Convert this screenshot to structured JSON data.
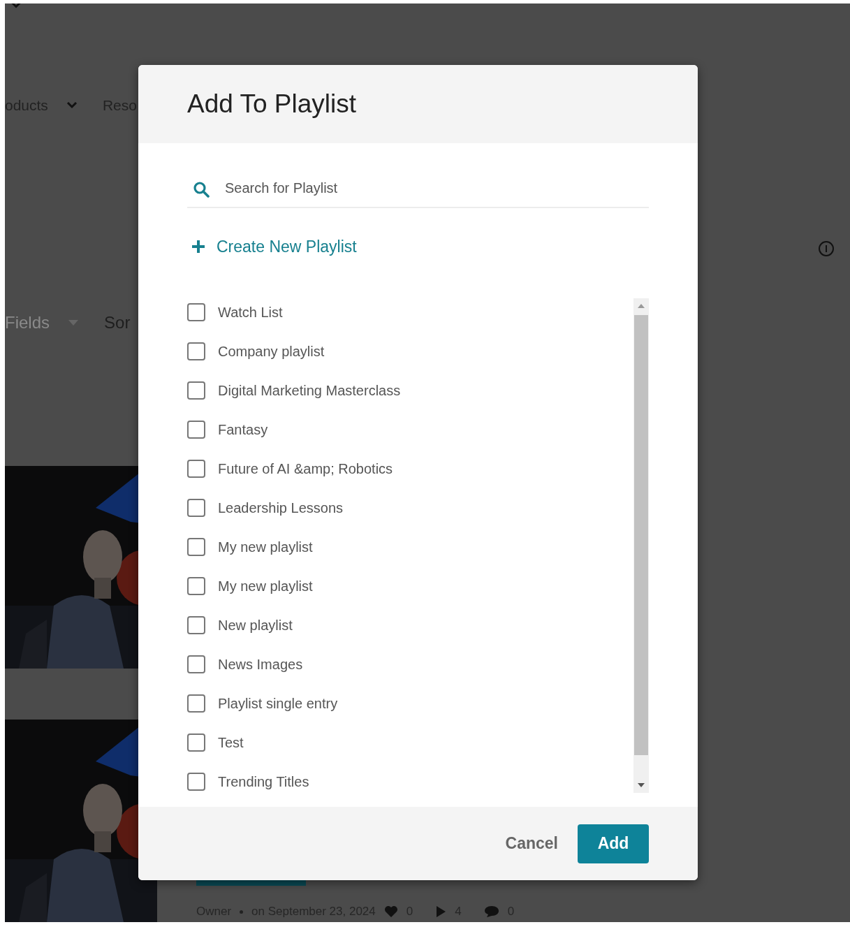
{
  "background": {
    "nav": [
      {
        "label": "oducts"
      },
      {
        "label": "Reso"
      }
    ],
    "filters": [
      {
        "label": "Fields",
        "disabled": true
      },
      {
        "label": "Sor",
        "disabled": false
      }
    ],
    "cards": [
      {
        "kind": "picture"
      },
      {
        "kind": "picture",
        "owner": "Owner",
        "date": "on September 23, 2024",
        "likes": "0",
        "plays": "4",
        "comments": "0"
      }
    ]
  },
  "dialog": {
    "title": "Add To Playlist",
    "search": {
      "placeholder": "Search for Playlist"
    },
    "create_label": "Create New Playlist",
    "playlists": [
      {
        "name": "Watch List",
        "checked": false
      },
      {
        "name": "Company playlist",
        "checked": false
      },
      {
        "name": "Digital Marketing Masterclass",
        "checked": false
      },
      {
        "name": "Fantasy",
        "checked": false
      },
      {
        "name": "Future of AI &amp; Robotics",
        "checked": false
      },
      {
        "name": "Leadership Lessons",
        "checked": false
      },
      {
        "name": "My new playlist",
        "checked": false
      },
      {
        "name": "My new playlist",
        "checked": false
      },
      {
        "name": "New playlist",
        "checked": false
      },
      {
        "name": "News Images",
        "checked": false
      },
      {
        "name": "Playlist single entry",
        "checked": false
      },
      {
        "name": "Test",
        "checked": false
      },
      {
        "name": "Trending Titles",
        "checked": false
      }
    ],
    "buttons": [
      {
        "label": "Cancel",
        "kind": "secondary"
      },
      {
        "label": "Add",
        "kind": "primary"
      }
    ]
  }
}
